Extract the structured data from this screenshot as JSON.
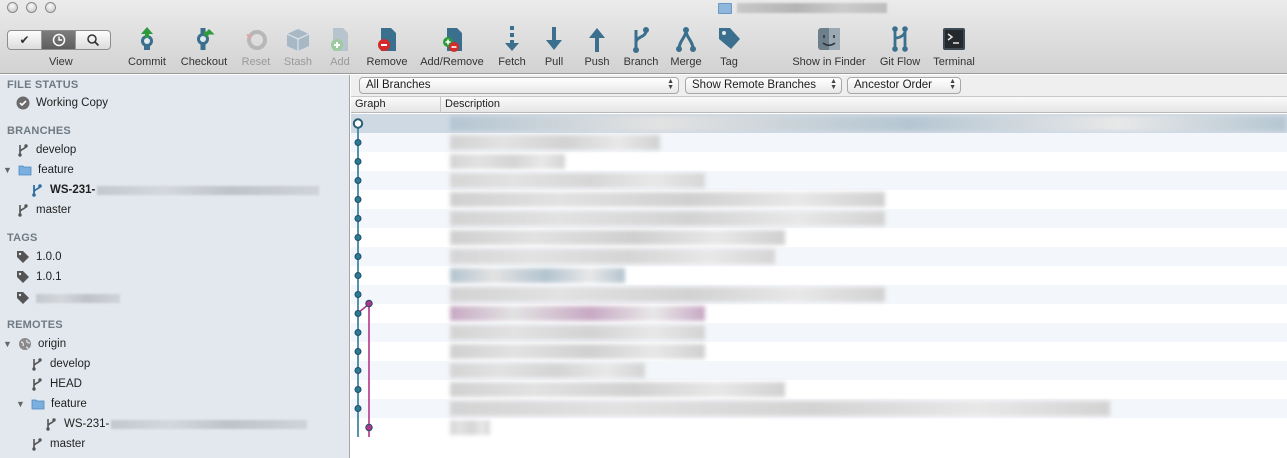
{
  "window": {
    "title_icon": "folder-icon"
  },
  "toolbar": {
    "view_label": "View",
    "view_segments": [
      "check-icon",
      "clock-icon",
      "search-icon"
    ],
    "buttons": [
      {
        "label": "Commit",
        "icon": "commit-icon",
        "enabled": true
      },
      {
        "label": "Checkout",
        "icon": "checkout-icon",
        "enabled": true
      },
      {
        "label": "Reset",
        "icon": "reset-icon",
        "enabled": false
      },
      {
        "label": "Stash",
        "icon": "stash-icon",
        "enabled": false
      },
      {
        "label": "Add",
        "icon": "add-icon",
        "enabled": false
      },
      {
        "label": "Remove",
        "icon": "remove-icon",
        "enabled": true
      },
      {
        "label": "Add/Remove",
        "icon": "add-remove-icon",
        "enabled": true
      },
      {
        "label": "Fetch",
        "icon": "fetch-icon",
        "enabled": true
      },
      {
        "label": "Pull",
        "icon": "pull-icon",
        "enabled": true
      },
      {
        "label": "Push",
        "icon": "push-icon",
        "enabled": true
      },
      {
        "label": "Branch",
        "icon": "branch-icon",
        "enabled": true
      },
      {
        "label": "Merge",
        "icon": "merge-icon",
        "enabled": true
      },
      {
        "label": "Tag",
        "icon": "tag-icon",
        "enabled": true
      },
      {
        "label": "Show in Finder",
        "icon": "finder-icon",
        "enabled": true
      },
      {
        "label": "Git Flow",
        "icon": "git-flow-icon",
        "enabled": true
      },
      {
        "label": "Terminal",
        "icon": "terminal-icon",
        "enabled": true
      }
    ]
  },
  "sidebar": {
    "file_status": {
      "header": "FILE STATUS",
      "items": [
        "Working Copy"
      ]
    },
    "branches": {
      "header": "BRANCHES",
      "develop": "develop",
      "feature_folder": "feature",
      "feature_branch": "WS-231-",
      "master": "master"
    },
    "tags": {
      "header": "TAGS",
      "items": [
        "1.0.0",
        "1.0.1"
      ]
    },
    "remotes": {
      "header": "REMOTES",
      "origin": "origin",
      "develop": "develop",
      "head": "HEAD",
      "feature_folder": "feature",
      "feature_branch": "WS-231-",
      "master": "master"
    }
  },
  "filters": {
    "branches": "All Branches",
    "remote": "Show Remote Branches",
    "order": "Ancestor Order"
  },
  "columns": {
    "graph": "Graph",
    "description": "Description"
  },
  "colors": {
    "graph_main": "#2b7a99",
    "graph_branch": "#b0358e",
    "selection": "#cfd9e4",
    "sidebar_bg": "#e3e8ee"
  }
}
